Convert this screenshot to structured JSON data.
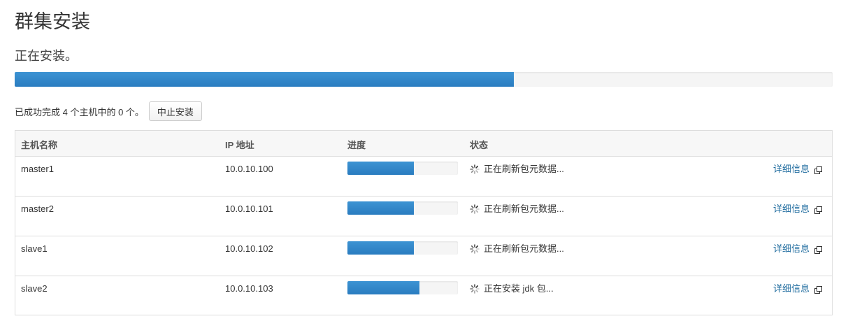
{
  "page": {
    "title": "群集安装",
    "subtitle": "正在安装。"
  },
  "overall_progress": 0.61,
  "summary": {
    "text": "已成功完成 4 个主机中的 0 个。",
    "abort_button": "中止安装"
  },
  "table": {
    "headers": {
      "host": "主机名称",
      "ip": "IP 地址",
      "progress": "进度",
      "status": "状态"
    },
    "rows": [
      {
        "host": "master1",
        "ip": "10.0.10.100",
        "progress": 0.6,
        "status": "正在刷新包元数据...",
        "detail": "详细信息"
      },
      {
        "host": "master2",
        "ip": "10.0.10.101",
        "progress": 0.6,
        "status": "正在刷新包元数据...",
        "detail": "详细信息"
      },
      {
        "host": "slave1",
        "ip": "10.0.10.102",
        "progress": 0.6,
        "status": "正在刷新包元数据...",
        "detail": "详细信息"
      },
      {
        "host": "slave2",
        "ip": "10.0.10.103",
        "progress": 0.65,
        "status": "正在安装 jdk 包...",
        "detail": "详细信息"
      }
    ]
  },
  "icons": {
    "spinner": "loading-spinner-icon",
    "external": "external-link-icon"
  },
  "colors": {
    "progress_fill": "#2f86c8",
    "link": "#1e6b9e",
    "header_bg": "#f7f7f7",
    "border": "#dddddd"
  }
}
